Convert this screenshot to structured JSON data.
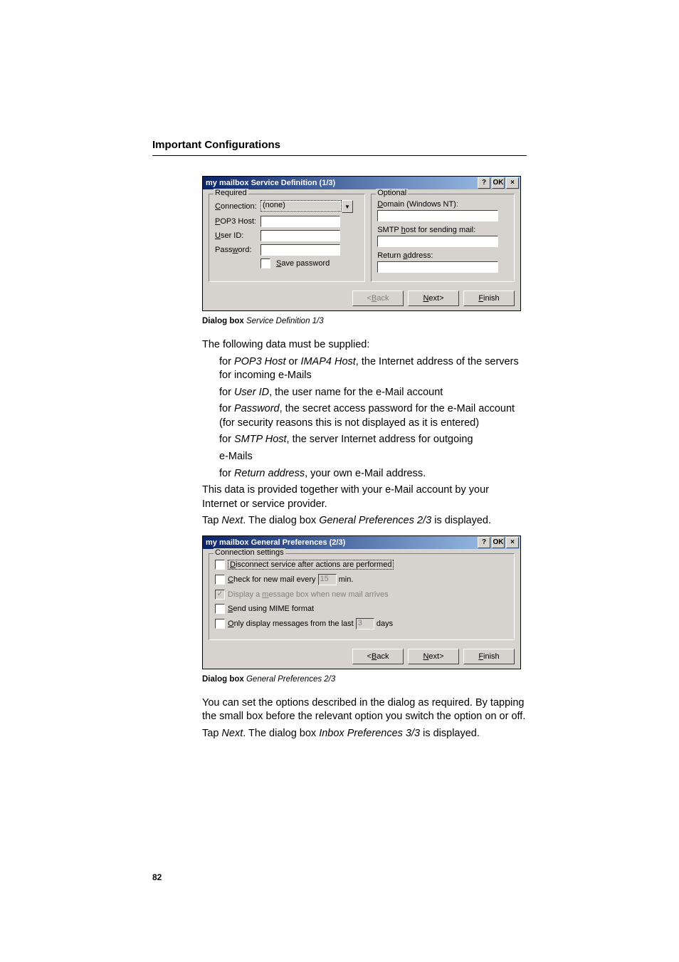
{
  "header": {
    "title": "Important Configurations"
  },
  "dialog1": {
    "title": "my mailbox Service Definition (1/3)",
    "help": "?",
    "ok": "OK",
    "close": "×",
    "required": {
      "legend": "Required",
      "connection_label": "Connection:",
      "connection_value": "(none)",
      "pop3_label": "POP3 Host:",
      "user_label": "User ID:",
      "password_label": "Password:",
      "save_pw": "Save password"
    },
    "optional": {
      "legend": "Optional",
      "domain_label": "Domain (Windows NT):",
      "smtp_label": "SMTP host for sending mail:",
      "return_label": "Return address:"
    },
    "btn_back": "<Back",
    "btn_next": "Next>",
    "btn_finish": "Finish"
  },
  "caption1": {
    "bold": "Dialog box",
    "italic": "Service Definition 1/3"
  },
  "text1": {
    "intro": "The following data must be supplied:",
    "l1a": "for ",
    "l1i": "POP3 Host",
    "l1b": " or ",
    "l1i2": "IMAP4 Host",
    "l1c": ", the Internet address of the servers for incoming e-Mails",
    "l2a": "for ",
    "l2i": "User ID",
    "l2b": ", the user name for the e-Mail account",
    "l3a": "for ",
    "l3i": "Password",
    "l3b": ", the secret access password for the e-Mail account (for security reasons this is not displayed as it is entered)",
    "l4a": "for ",
    "l4i": "SMTP Host",
    "l4b": ", the server Internet address for outgoing",
    "l4c": "e-Mails",
    "l5a": "for ",
    "l5i": "Return address",
    "l5b": ", your own e-Mail address.",
    "p1": "This data is provided together with your e-Mail account by your Internet or service provider.",
    "p2a": "Tap ",
    "p2i": "Next",
    "p2b": ". The dialog box ",
    "p2i2": "General Preferences 2/3",
    "p2c": " is displayed."
  },
  "dialog2": {
    "title": "my mailbox General Preferences (2/3)",
    "help": "?",
    "ok": "OK",
    "close": "×",
    "legend": "Connection settings",
    "c1": "Disconnect service after actions are performed",
    "c2a": "Check for new mail every",
    "c2v": "15",
    "c2b": "min.",
    "c3": "Display a message box when new mail arrives",
    "c4": "Send using MIME format",
    "c5a": "Only display messages from the last",
    "c5v": "3",
    "c5b": "days",
    "btn_back": "<Back",
    "btn_next": "Next>",
    "btn_finish": "Finish"
  },
  "caption2": {
    "bold": "Dialog box",
    "italic": "General Preferences 2/3"
  },
  "text2": {
    "p1": "You can set the options described in the dialog as required. By tapping the small box before the relevant option you switch the option on or off.",
    "p2a": "Tap ",
    "p2i": "Next",
    "p2b": ". The dialog box ",
    "p2i2": "Inbox Preferences 3/3",
    "p2c": " is displayed."
  },
  "page_number": "82"
}
